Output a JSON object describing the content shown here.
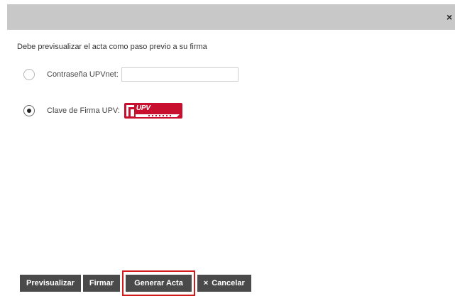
{
  "dialog": {
    "close_glyph": "×",
    "instruction": "Debe previsualizar el acta como paso previo a su firma"
  },
  "options": {
    "password": {
      "label": "Contraseña UPVnet:",
      "value": "",
      "selected": false
    },
    "signature": {
      "label": "Clave de Firma UPV:",
      "selected": true,
      "logo_text": "UPV"
    }
  },
  "buttons": {
    "preview": "Previsualizar",
    "sign": "Firmar",
    "generate": "Generar Acta",
    "cancel": "Cancelar",
    "cancel_glyph": "×"
  },
  "colors": {
    "titlebar": "#c8c8c8",
    "button": "#4a4a4a",
    "highlight": "#d11a1a",
    "upv_red": "#c8102e"
  },
  "icons": {
    "close": "close-icon",
    "cancel": "x-icon",
    "logo": "upv-logo"
  }
}
